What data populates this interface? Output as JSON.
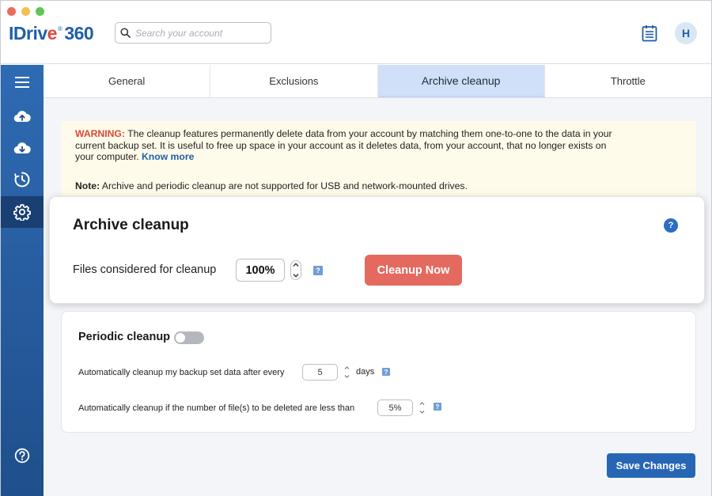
{
  "window": {
    "traffic_lights": {
      "close": "#ed6a5e",
      "minimize": "#f5bf4f",
      "zoom": "#61c554"
    }
  },
  "header": {
    "logo": {
      "part1": "IDriv",
      "part2": "e",
      "reg": "®",
      "part3": "360"
    },
    "search": {
      "placeholder": "Search your account"
    },
    "avatar_initial": "H"
  },
  "sidebar": {
    "items": [
      {
        "icon": "menu-icon"
      },
      {
        "icon": "cloud-upload-icon"
      },
      {
        "icon": "cloud-download-icon"
      },
      {
        "icon": "history-clock-icon"
      },
      {
        "icon": "gear-icon",
        "active": true
      },
      {
        "icon": "help-icon"
      }
    ]
  },
  "tabs": [
    {
      "label": "General"
    },
    {
      "label": "Exclusions"
    },
    {
      "label": "Archive cleanup",
      "active": true
    },
    {
      "label": "Throttle"
    }
  ],
  "warning": {
    "label": "WARNING:",
    "text": " The cleanup features permanently delete data from your account by matching them one-to-one to the data in your current backup set. It is useful to free up space in your account as it deletes data, from your account, that no longer exists on your computer. ",
    "link": "Know more",
    "note_label": "Note:",
    "note_text": " Archive and periodic cleanup are not supported for USB and network-mounted drives."
  },
  "archive_cleanup": {
    "title": "Archive cleanup",
    "help": "?",
    "files_label": "Files considered for cleanup",
    "files_value": "100%",
    "inline_help": "?",
    "cleanup_button": "Cleanup Now"
  },
  "periodic_cleanup": {
    "title": "Periodic cleanup",
    "enabled": false,
    "row1_label": "Automatically cleanup my backup set data after every",
    "row1_value": "5",
    "row1_unit": "days",
    "row1_help": "?",
    "row2_label": "Automatically cleanup if the number of file(s) to be deleted are less than",
    "row2_value": "5%",
    "row2_help": "?"
  },
  "footer": {
    "save_button": "Save Changes"
  },
  "colors": {
    "brand_blue": "#1f5fa8",
    "warning_red": "#d9493a",
    "cleanup_button": "#e4695f",
    "save_button": "#2766b5",
    "active_tab": "#cfe0f8"
  }
}
